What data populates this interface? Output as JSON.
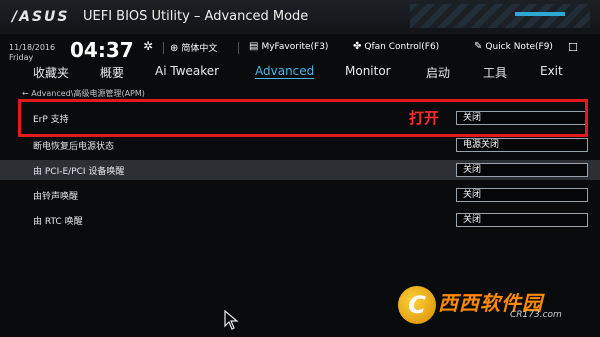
{
  "window": {
    "logo": "/ASUS",
    "title": "UEFI BIOS Utility – Advanced Mode"
  },
  "status": {
    "date": "11/18/2016",
    "day": "Friday",
    "time": "04:37",
    "items": [
      {
        "icon": "globe-icon",
        "label": "简体中文"
      },
      {
        "icon": "favorite-icon",
        "label": "MyFavorite(F3)"
      },
      {
        "icon": "fan-icon",
        "label": "Qfan Control(F6)"
      },
      {
        "icon": "note-icon",
        "label": "Quick Note(F9)"
      }
    ]
  },
  "menu": {
    "items": [
      "收藏夹",
      "概要",
      "Ai Tweaker",
      "Advanced",
      "Monitor",
      "启动",
      "工具",
      "Exit"
    ],
    "active": "Advanced"
  },
  "breadcrumb": "← Advanced\\高级电源管理(APM)",
  "settings": [
    {
      "label": "ErP 支持",
      "value": "关闭",
      "selected": false
    },
    {
      "label": "断电恢复后电源状态",
      "value": "电源关闭",
      "selected": false
    },
    {
      "label": "由 PCI-E/PCI 设备唤醒",
      "value": "关闭",
      "selected": true
    },
    {
      "label": "由铃声唤醒",
      "value": "关闭",
      "selected": false
    },
    {
      "label": "由 RTC 唤醒",
      "value": "关闭",
      "selected": false
    }
  ],
  "annotation": {
    "text": "打开",
    "color": "#e11b1b"
  },
  "watermark": {
    "mark": "C",
    "text": "西西软件园",
    "sub": "CR173.com"
  },
  "colors": {
    "accent": "#45b6e6",
    "highlight": "#e11b1b",
    "background": "#0a0b0d"
  }
}
